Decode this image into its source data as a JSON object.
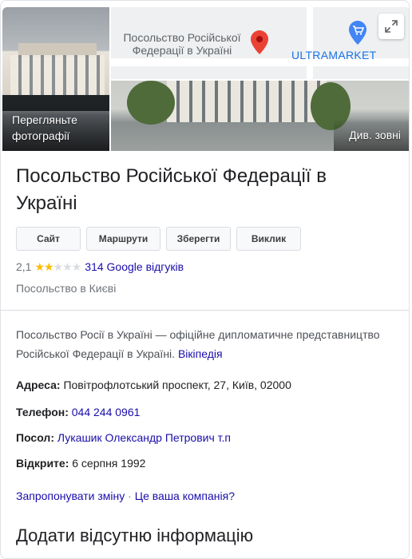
{
  "media": {
    "photos_label": "Перегляньте фотографії",
    "street_label": "Див. зовні",
    "map": {
      "place_label": "Посольство Російської Федерації в Україні",
      "store_label": "ULTRAMARKET",
      "pin_color": "#ea4335",
      "store_pin_color": "#4285f4"
    },
    "expand_icon": "expand-icon"
  },
  "header": {
    "title": "Посольство Російської Федерації в Україні",
    "actions": [
      "Сайт",
      "Маршрути",
      "Зберегти",
      "Виклик"
    ],
    "rating": "2,1",
    "rating_value": 2.1,
    "rating_max": 5,
    "reviews_link": "314 Google відгуків",
    "category": "Посольство в Києві"
  },
  "details": {
    "description": "Посольство Росії в Україні — офіційне дипломатичне представництво Російської Федерації в Україні.",
    "description_link": "Вікіпедія",
    "address_label": "Адреса:",
    "address_value": "Повітрофлотський проспект, 27, Київ, 02000",
    "phone_label": "Телефон:",
    "phone_value": "044 244 0961",
    "ambassador_label": "Посол:",
    "ambassador_value": "Лукашик Олександр Петрович т.п",
    "opened_label": "Відкрите:",
    "opened_value": "6 серпня 1992"
  },
  "footer": {
    "suggest_edit": "Запропонувати зміну",
    "separator": "·",
    "own_business": "Це ваша компанія?",
    "add_info_title": "Додати відсутню інформацію"
  },
  "colors": {
    "link": "#1a0dab",
    "star": "#fbbc04",
    "muted": "#70757a"
  }
}
